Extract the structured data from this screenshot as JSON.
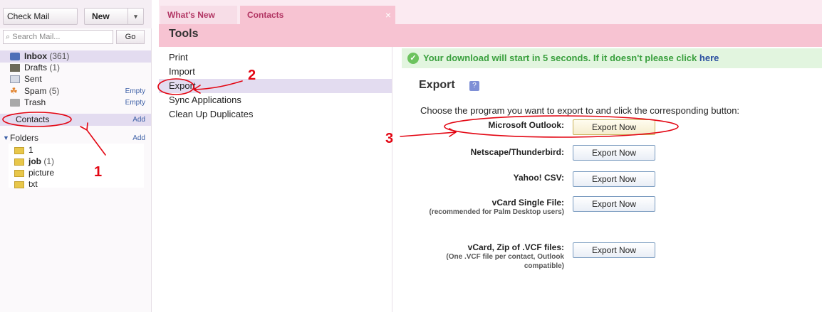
{
  "sidebar": {
    "check_mail": "Check Mail",
    "new_label": "New",
    "new_caret": "▾",
    "search_placeholder": "Search Mail...",
    "go_label": "Go",
    "items": [
      {
        "label": "Inbox",
        "count": "(361)",
        "icon": "inbox-icon"
      },
      {
        "label": "Drafts",
        "count": "(1)",
        "icon": "drafts-icon"
      },
      {
        "label": "Sent",
        "count": "",
        "icon": "sent-icon"
      },
      {
        "label": "Spam",
        "count": "(5)",
        "icon": "spam-icon",
        "action": "Empty"
      },
      {
        "label": "Trash",
        "count": "",
        "icon": "trash-icon",
        "action": "Empty"
      }
    ],
    "contacts_label": "Contacts",
    "contacts_action": "Add",
    "folders_label": "Folders",
    "folders_action": "Add",
    "folders": [
      {
        "label": "1",
        "count": ""
      },
      {
        "label": "job",
        "count": "(1)"
      },
      {
        "label": "picture",
        "count": ""
      },
      {
        "label": "txt",
        "count": ""
      }
    ]
  },
  "tabs": [
    {
      "label": "What's New"
    },
    {
      "label": "Contacts"
    }
  ],
  "tab_close": "×",
  "tools_title": "Tools",
  "tools_menu": [
    "Print",
    "Import",
    "Export",
    "Sync Applications",
    "Clean Up Duplicates"
  ],
  "notice": {
    "text": "Your download will start in 5 seconds. If it doesn't please click",
    "link": "here"
  },
  "export": {
    "title": "Export",
    "help": "?",
    "instructions": "Choose the program you want to export to and click the corresponding button:",
    "button_label": "Export Now",
    "programs": [
      {
        "name": "Microsoft Outlook:",
        "sub": ""
      },
      {
        "name": "Netscape/Thunderbird:",
        "sub": ""
      },
      {
        "name": "Yahoo! CSV:",
        "sub": ""
      },
      {
        "name": "vCard Single File:",
        "sub": "(recommended for Palm Desktop users)"
      },
      {
        "name": "vCard, Zip of .VCF files:",
        "sub": "(One .VCF file per contact, Outlook compatible)"
      }
    ]
  },
  "annotations": [
    "1",
    "2",
    "3"
  ],
  "colors": {
    "annotation": "#e30613",
    "accent_pink": "#f7c3d2",
    "selection": "#e3dcf0",
    "notice_green": "#3aa03e"
  }
}
